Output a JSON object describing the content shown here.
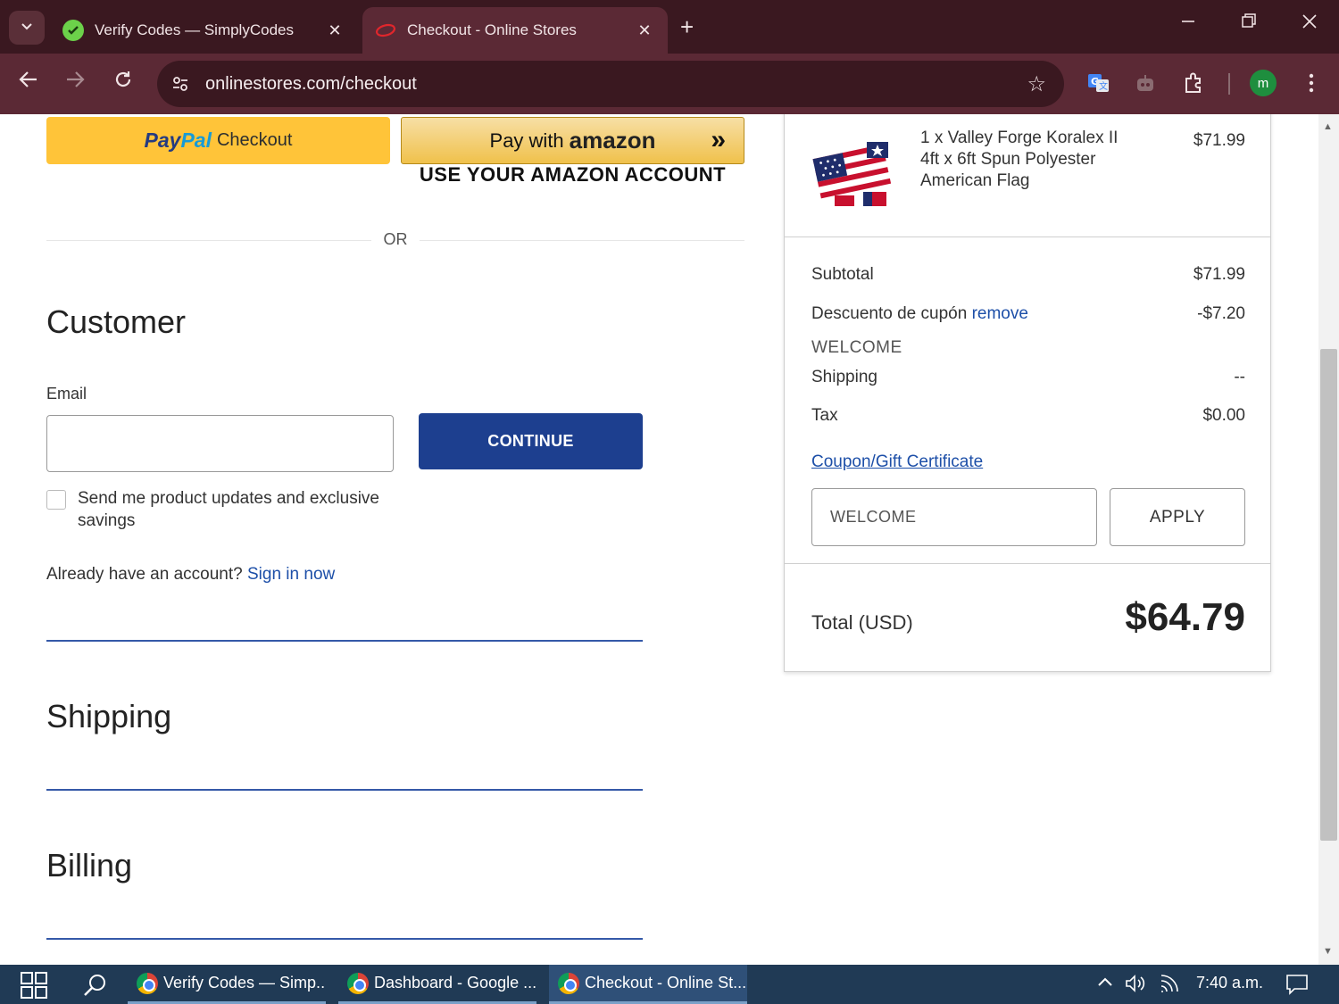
{
  "browser": {
    "tabs": [
      {
        "title": "Verify Codes — SimplyCodes",
        "active": false
      },
      {
        "title": "Checkout - Online Stores",
        "active": true
      }
    ],
    "url": "onlinestores.com/checkout",
    "profile_initial": "m"
  },
  "payments": {
    "paypal_pay": "Pay",
    "paypal_pal": "Pal",
    "paypal_label": "Checkout",
    "amazon_prefix": "Pay with",
    "amazon_brand": "amazon",
    "amazon_caption": "USE YOUR AMAZON ACCOUNT",
    "or_text": "OR"
  },
  "customer": {
    "title": "Customer",
    "email_label": "Email",
    "email_value": "",
    "continue_label": "CONTINUE",
    "updates_label": "Send me product updates and exclusive savings",
    "account_prompt": "Already have an account?",
    "sign_in_label": "Sign in now"
  },
  "sections": {
    "shipping_title": "Shipping",
    "billing_title": "Billing"
  },
  "summary": {
    "item_name": "1 x Valley Forge Koralex II 4ft x 6ft Spun Polyester American Flag",
    "item_price": "$71.99",
    "subtotal_label": "Subtotal",
    "subtotal_value": "$71.99",
    "discount_label": "Descuento de cupón",
    "discount_remove": "remove",
    "discount_code": "WELCOME",
    "discount_value": "-$7.20",
    "shipping_label": "Shipping",
    "shipping_value": "--",
    "tax_label": "Tax",
    "tax_value": "$0.00",
    "coupon_link": "Coupon/Gift Certificate",
    "coupon_value": "WELCOME",
    "apply_label": "APPLY",
    "total_label": "Total (USD)",
    "total_value": "$64.79"
  },
  "taskbar": {
    "tasks": [
      {
        "title": "Verify Codes — Simp..."
      },
      {
        "title": "Dashboard - Google ..."
      },
      {
        "title": "Checkout - Online St..."
      }
    ],
    "time": "7:40 a.m."
  },
  "colors": {
    "primary_button": "#1d3f8f",
    "link": "#1d4fa8",
    "paypal_yellow": "#ffc439",
    "chrome_frame": "#5b2935"
  }
}
